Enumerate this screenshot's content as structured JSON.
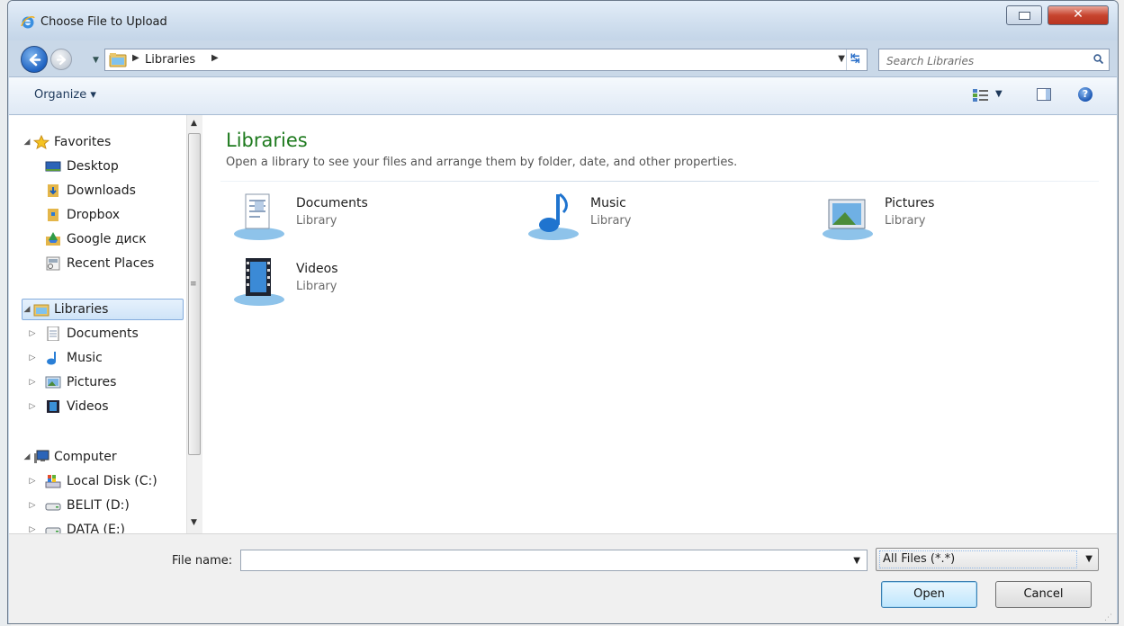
{
  "window": {
    "title": "Choose File to Upload"
  },
  "address": {
    "crumb": "Libraries"
  },
  "search": {
    "placeholder": "Search Libraries"
  },
  "toolbar": {
    "organize_label": "Organize ▾"
  },
  "nav": {
    "favorites": {
      "label": "Favorites",
      "items": [
        "Desktop",
        "Downloads",
        "Dropbox",
        "Google диск",
        "Recent Places"
      ]
    },
    "libraries": {
      "label": "Libraries",
      "items": [
        "Documents",
        "Music",
        "Pictures",
        "Videos"
      ]
    },
    "computer": {
      "label": "Computer",
      "items": [
        "Local Disk (C:)",
        "BELIT (D:)",
        "DATA (E:)"
      ]
    }
  },
  "content": {
    "title": "Libraries",
    "description": "Open a library to see your files and arrange them by folder, date, and other properties.",
    "libraries": [
      {
        "name": "Documents",
        "type": "Library",
        "icon": "documents-library-icon"
      },
      {
        "name": "Music",
        "type": "Library",
        "icon": "music-library-icon"
      },
      {
        "name": "Pictures",
        "type": "Library",
        "icon": "pictures-library-icon"
      },
      {
        "name": "Videos",
        "type": "Library",
        "icon": "videos-library-icon"
      }
    ]
  },
  "footer": {
    "file_name_label": "File name:",
    "file_name_value": "",
    "file_type": "All Files (*.*)",
    "open_label": "Open",
    "cancel_label": "Cancel"
  },
  "colors": {
    "title_green": "#1e7a1e",
    "selection": "#cfe4f8",
    "close_red": "#c7452f"
  }
}
